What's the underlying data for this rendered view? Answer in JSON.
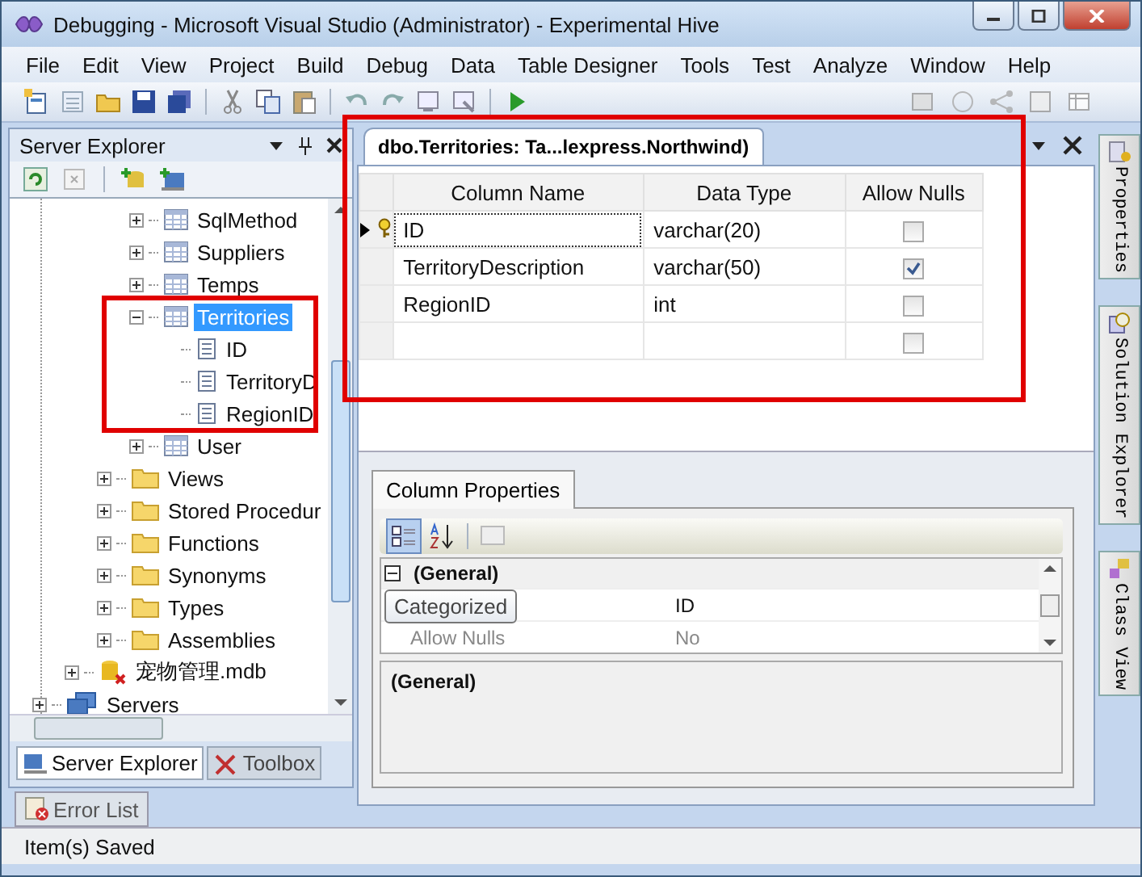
{
  "window": {
    "title": "Debugging - Microsoft Visual Studio (Administrator) - Experimental Hive"
  },
  "menu": [
    "File",
    "Edit",
    "View",
    "Project",
    "Build",
    "Debug",
    "Data",
    "Table Designer",
    "Tools",
    "Test",
    "Analyze",
    "Window",
    "Help"
  ],
  "server_explorer": {
    "title": "Server Explorer",
    "tree": [
      {
        "children": [
          {
            "children": [
              {
                "children": [
                  {
                    "label": "SqlMethod",
                    "kind": "table",
                    "expanded": false,
                    "selected": false
                  },
                  {
                    "label": "Suppliers",
                    "kind": "table",
                    "expanded": false,
                    "selected": false
                  },
                  {
                    "label": "Temps",
                    "kind": "table",
                    "expanded": false,
                    "selected": false
                  },
                  {
                    "label": "Territories",
                    "kind": "table",
                    "expanded": true,
                    "selected": true,
                    "children": [
                      {
                        "label": "ID",
                        "kind": "column",
                        "selected": false
                      },
                      {
                        "label": "TerritoryD",
                        "kind": "column",
                        "selected": false
                      },
                      {
                        "label": "RegionID",
                        "kind": "column",
                        "selected": false
                      }
                    ]
                  },
                  {
                    "label": "User",
                    "kind": "table",
                    "expanded": false,
                    "selected": false
                  }
                ]
              },
              {
                "label": "Views",
                "kind": "folder",
                "expanded": false,
                "selected": false
              },
              {
                "label": "Stored Procedur",
                "kind": "folder",
                "expanded": false,
                "selected": false
              },
              {
                "label": "Functions",
                "kind": "folder",
                "expanded": false,
                "selected": false
              },
              {
                "label": "Synonyms",
                "kind": "folder",
                "expanded": false,
                "selected": false
              },
              {
                "label": "Types",
                "kind": "folder",
                "expanded": false,
                "selected": false
              },
              {
                "label": "Assemblies",
                "kind": "folder",
                "expanded": false,
                "selected": false
              }
            ]
          },
          {
            "label": "宠物管理.mdb",
            "kind": "database",
            "expanded": false,
            "selected": false
          }
        ]
      },
      {
        "label": "Servers",
        "kind": "servers",
        "expanded": false,
        "selected": false
      }
    ],
    "tabs": [
      {
        "label": "Server Explorer",
        "selected": true
      },
      {
        "label": "Toolbox",
        "selected": false
      }
    ]
  },
  "document": {
    "tab": "dbo.Territories: Ta...lexpress.Northwind)",
    "columns": [
      "Column Name",
      "Data Type",
      "Allow Nulls"
    ],
    "rows": [
      {
        "name": "ID",
        "type": "varchar(20)",
        "allow_nulls": false,
        "primary_key": true,
        "current": true
      },
      {
        "name": "TerritoryDescription",
        "type": "varchar(50)",
        "allow_nulls": true,
        "primary_key": false,
        "current": false
      },
      {
        "name": "RegionID",
        "type": "int",
        "allow_nulls": false,
        "primary_key": false,
        "current": false
      },
      {
        "allow_nulls": false,
        "primary_key": false,
        "current": false
      }
    ]
  },
  "column_properties": {
    "tab": "Column Properties",
    "category": "(General)",
    "properties": [
      {
        "value": "ID"
      },
      {
        "label": "Allow Nulls",
        "value": "No"
      }
    ],
    "tooltip": "Categorized",
    "description": "(General)"
  },
  "side_tabs": [
    "Properties",
    "Solution Explorer",
    "Class View"
  ],
  "bottom_tabs": [
    "Error List"
  ],
  "status_bar": "Item(s) Saved"
}
